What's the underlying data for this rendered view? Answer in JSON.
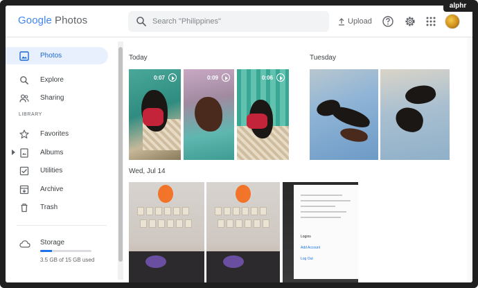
{
  "app": {
    "logo_word": "Google",
    "logo_product": "Photos",
    "watermark": "alphr"
  },
  "search": {
    "placeholder": "Search \"Philippines\""
  },
  "header": {
    "upload_label": "Upload"
  },
  "sidebar": {
    "items": [
      {
        "label": "Photos",
        "icon": "photo-icon",
        "active": true
      },
      {
        "label": "Explore",
        "icon": "search-icon",
        "active": false
      },
      {
        "label": "Sharing",
        "icon": "people-icon",
        "active": false
      }
    ],
    "section_label": "LIBRARY",
    "library": [
      {
        "label": "Favorites",
        "icon": "star-icon"
      },
      {
        "label": "Albums",
        "icon": "album-icon"
      },
      {
        "label": "Utilities",
        "icon": "checkbox-icon"
      },
      {
        "label": "Archive",
        "icon": "archive-icon"
      },
      {
        "label": "Trash",
        "icon": "trash-icon"
      }
    ],
    "storage": {
      "label": "Storage",
      "usage_text": "3.5 GB of 15 GB used",
      "used_fraction": 0.2333
    }
  },
  "main": {
    "groups": [
      {
        "title": "Today",
        "photos": [
          {
            "type": "video",
            "duration": "0:07"
          },
          {
            "type": "video",
            "duration": "0:09"
          },
          {
            "type": "video",
            "duration": "0:06"
          }
        ]
      },
      {
        "title": "Tuesday",
        "photos": [
          {
            "type": "photo"
          },
          {
            "type": "photo"
          }
        ]
      },
      {
        "title": "Wed, Jul 14",
        "photos": [
          {
            "type": "photo"
          },
          {
            "type": "photo"
          },
          {
            "type": "screenshot",
            "lines": [
              "Logins",
              "Add Account",
              "Log Out"
            ]
          }
        ]
      }
    ]
  },
  "colors": {
    "accent": "#1a73e8",
    "active_bg": "#e8f0fe",
    "active_text": "#1967d2"
  }
}
